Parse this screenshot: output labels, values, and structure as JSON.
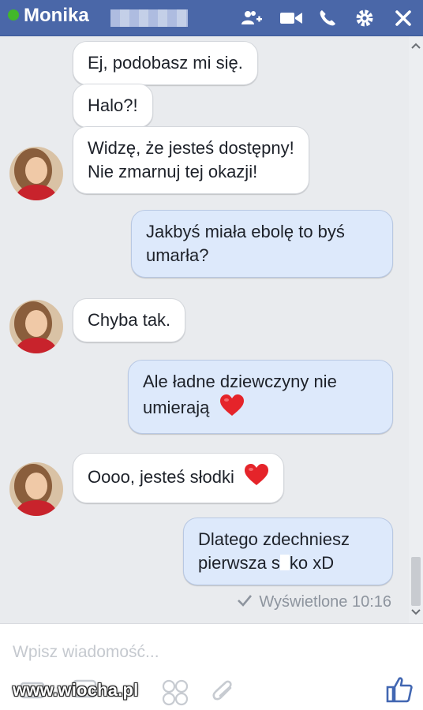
{
  "header": {
    "contact_name": "Monika",
    "icons": [
      "add-people-icon",
      "video-call-icon",
      "phone-icon",
      "gear-icon",
      "close-icon"
    ],
    "bg_color": "#4a67a8",
    "online_color": "#42b72a"
  },
  "messages": [
    {
      "from": "them",
      "text": "Ej, podobasz mi się."
    },
    {
      "from": "them",
      "text": "Halo?!"
    },
    {
      "from": "them",
      "lines": [
        "Widzę, że jesteś dostępny!",
        "Nie zmarnuj tej okazji!"
      ]
    },
    {
      "from": "me",
      "lines": [
        "Jakbyś miała ebolę to byś",
        "umarła?"
      ]
    },
    {
      "from": "them",
      "text": "Chyba tak."
    },
    {
      "from": "me",
      "lines": [
        "Ale ładne dziewczyny nie",
        "umierają"
      ],
      "emoji": "heart-icon"
    },
    {
      "from": "them",
      "text": "Oooo, jesteś słodki",
      "emoji": "heart-icon"
    },
    {
      "from": "me",
      "lines": [
        "Dlatego zdechniesz",
        "pierwsza s",
        "ko xD"
      ]
    }
  ],
  "status": {
    "seen_text": "Wyświetlone 10:16"
  },
  "composer": {
    "placeholder": "Wpisz wiadomość...",
    "icons": [
      "camera-icon",
      "gif-icon",
      "sticker-icon",
      "attach-icon",
      "like-icon"
    ]
  },
  "watermark": "www.wiocha.pl",
  "colors": {
    "incoming_bubble": "#ffffff",
    "outgoing_bubble": "#dde9fb",
    "chat_bg": "#e9ebee",
    "heart": "#e5242a",
    "like": "#4267b2"
  }
}
